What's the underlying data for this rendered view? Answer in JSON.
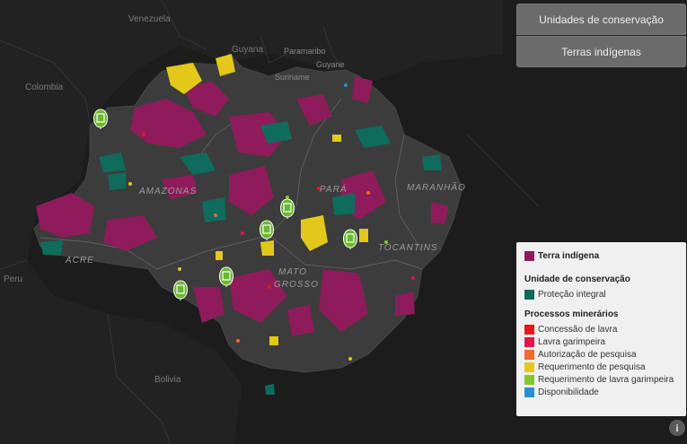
{
  "buttons": {
    "unidades": "Unidades de conservação",
    "terras": "Terras indígenas"
  },
  "map_labels": {
    "venezuela": "Venezuela",
    "guyana": "Guyana",
    "paramaribo": "Paramaribo",
    "suriname": "Suriname",
    "guyane": "Guyane",
    "colombia": "Colombia",
    "peru": "Peru",
    "bolivia": "Bolivia",
    "amazonas": "AMAZONAS",
    "para": "PARÁ",
    "maranhao": "MARANHÃO",
    "tocantins": "TOCANTINS",
    "acre": "ACRE",
    "mato1": "MATO",
    "mato2": "GROSSO"
  },
  "legend": {
    "terra_indigena": "Terra indígena",
    "uc_title": "Unidade de conservação",
    "protecao": "Proteção integral",
    "processos_title": "Processos minerários",
    "items": [
      "Concessão de lavra",
      "Lavra garimpeira",
      "Autorização de pesquisa",
      "Requerimento de pesquisa",
      "Requerimento de lavra garimpeira",
      "Disponibilidade"
    ]
  },
  "colors": {
    "terra_indigena": "#8e1c5a",
    "protecao_integral": "#0f6b5c",
    "concessao": "#e8151b",
    "lavra_garimpeira": "#e0154f",
    "autorizacao": "#f06a2c",
    "requerimento_pesquisa": "#e2c81a",
    "requerimento_lavra": "#86c532",
    "disponibilidade": "#2a8fd0",
    "marker": "#6ab82f"
  },
  "info_glyph": "i"
}
